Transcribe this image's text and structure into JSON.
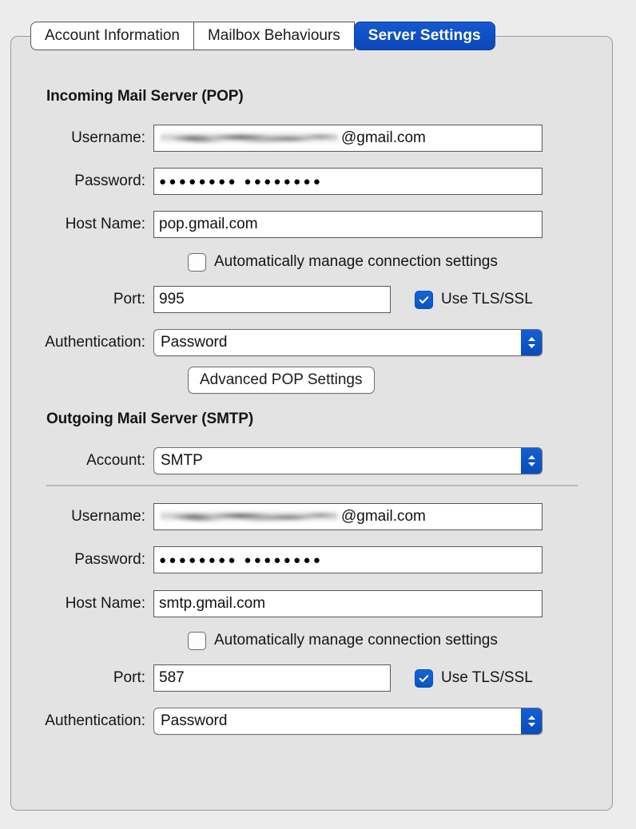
{
  "tabs": [
    {
      "label": "Account Information",
      "selected": false
    },
    {
      "label": "Mailbox Behaviours",
      "selected": false
    },
    {
      "label": "Server Settings",
      "selected": true
    }
  ],
  "colors": {
    "accent_blue": "#0a4cbb",
    "window_background": "#ececec",
    "panel_background": "#e3e3e3",
    "field_border": "#58585a"
  },
  "incoming": {
    "title": "Incoming Mail Server (POP)",
    "username": {
      "label": "Username:",
      "redacted_value": "",
      "domain_suffix": "@gmail.com"
    },
    "password": {
      "label": "Password:",
      "masked_value": "●●●●●●●● ●●●●●●●●"
    },
    "host": {
      "label": "Host Name:",
      "value": "pop.gmail.com"
    },
    "auto_manage": {
      "label": "Automatically manage connection settings",
      "checked": false
    },
    "port": {
      "label": "Port:",
      "value": "995"
    },
    "tls": {
      "label": "Use TLS/SSL",
      "checked": true
    },
    "authentication": {
      "label": "Authentication:",
      "value": "Password"
    },
    "advanced_button": "Advanced POP Settings"
  },
  "outgoing": {
    "title": "Outgoing Mail Server (SMTP)",
    "account": {
      "label": "Account:",
      "value": "SMTP"
    },
    "username": {
      "label": "Username:",
      "redacted_value": "",
      "domain_suffix": "@gmail.com"
    },
    "password": {
      "label": "Password:",
      "masked_value": "●●●●●●●● ●●●●●●●●"
    },
    "host": {
      "label": "Host Name:",
      "value": "smtp.gmail.com"
    },
    "auto_manage": {
      "label": "Automatically manage connection settings",
      "checked": false
    },
    "port": {
      "label": "Port:",
      "value": "587"
    },
    "tls": {
      "label": "Use TLS/SSL",
      "checked": true
    },
    "authentication": {
      "label": "Authentication:",
      "value": "Password"
    }
  }
}
